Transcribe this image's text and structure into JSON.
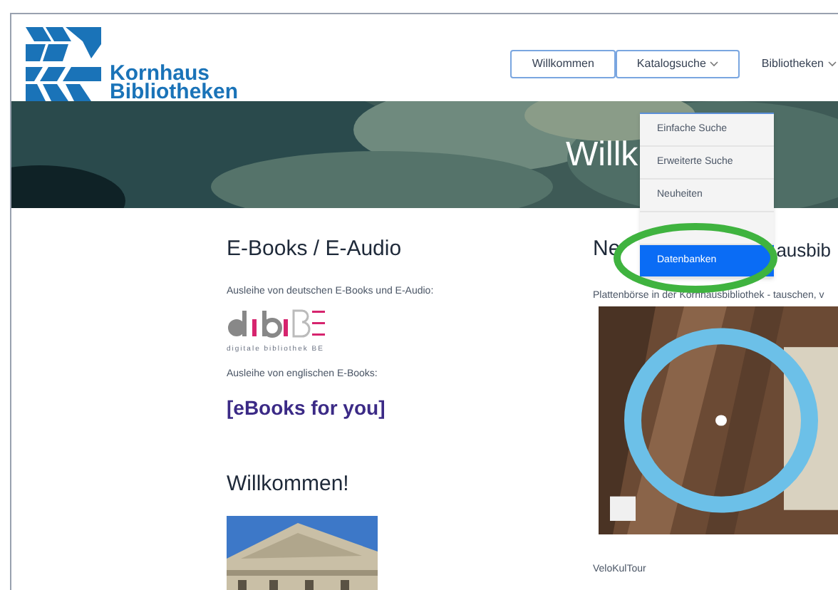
{
  "logo": {
    "line1": "Kornhaus",
    "line2": "Bibliotheken"
  },
  "nav": [
    {
      "label": "Willkommen",
      "outlined": true,
      "has_caret": false
    },
    {
      "label": "Katalogsuche",
      "outlined": true,
      "has_caret": true
    },
    {
      "label": "Bibliotheken",
      "outlined": false,
      "has_caret": true
    }
  ],
  "hero": {
    "title": "Willk"
  },
  "dropdown": [
    {
      "label": "Einfache Suche",
      "selected": false
    },
    {
      "label": "Erweiterte Suche",
      "selected": false
    },
    {
      "label": "Neuheiten",
      "selected": false
    },
    {
      "selected": false
    },
    {
      "label": "Datenbanken",
      "selected": true
    }
  ],
  "left": {
    "heading": "E-Books / E-Audio",
    "german_note": "Ausleihe von deutschen E-Books und E-Audio:",
    "dibibe_caption": "digitale bibliothek BE",
    "english_note": "Ausleihe von englischen E-Books:",
    "ebooks_logo": "[eBooks for you]",
    "welcome_heading": "Willkommen!"
  },
  "right": {
    "heading_start": "Ne",
    "heading_end": "ausbib",
    "post_title": "Plattenbörse in der Kornhausbibliothek - tauschen, v",
    "next_post": "VeloKulTour"
  }
}
